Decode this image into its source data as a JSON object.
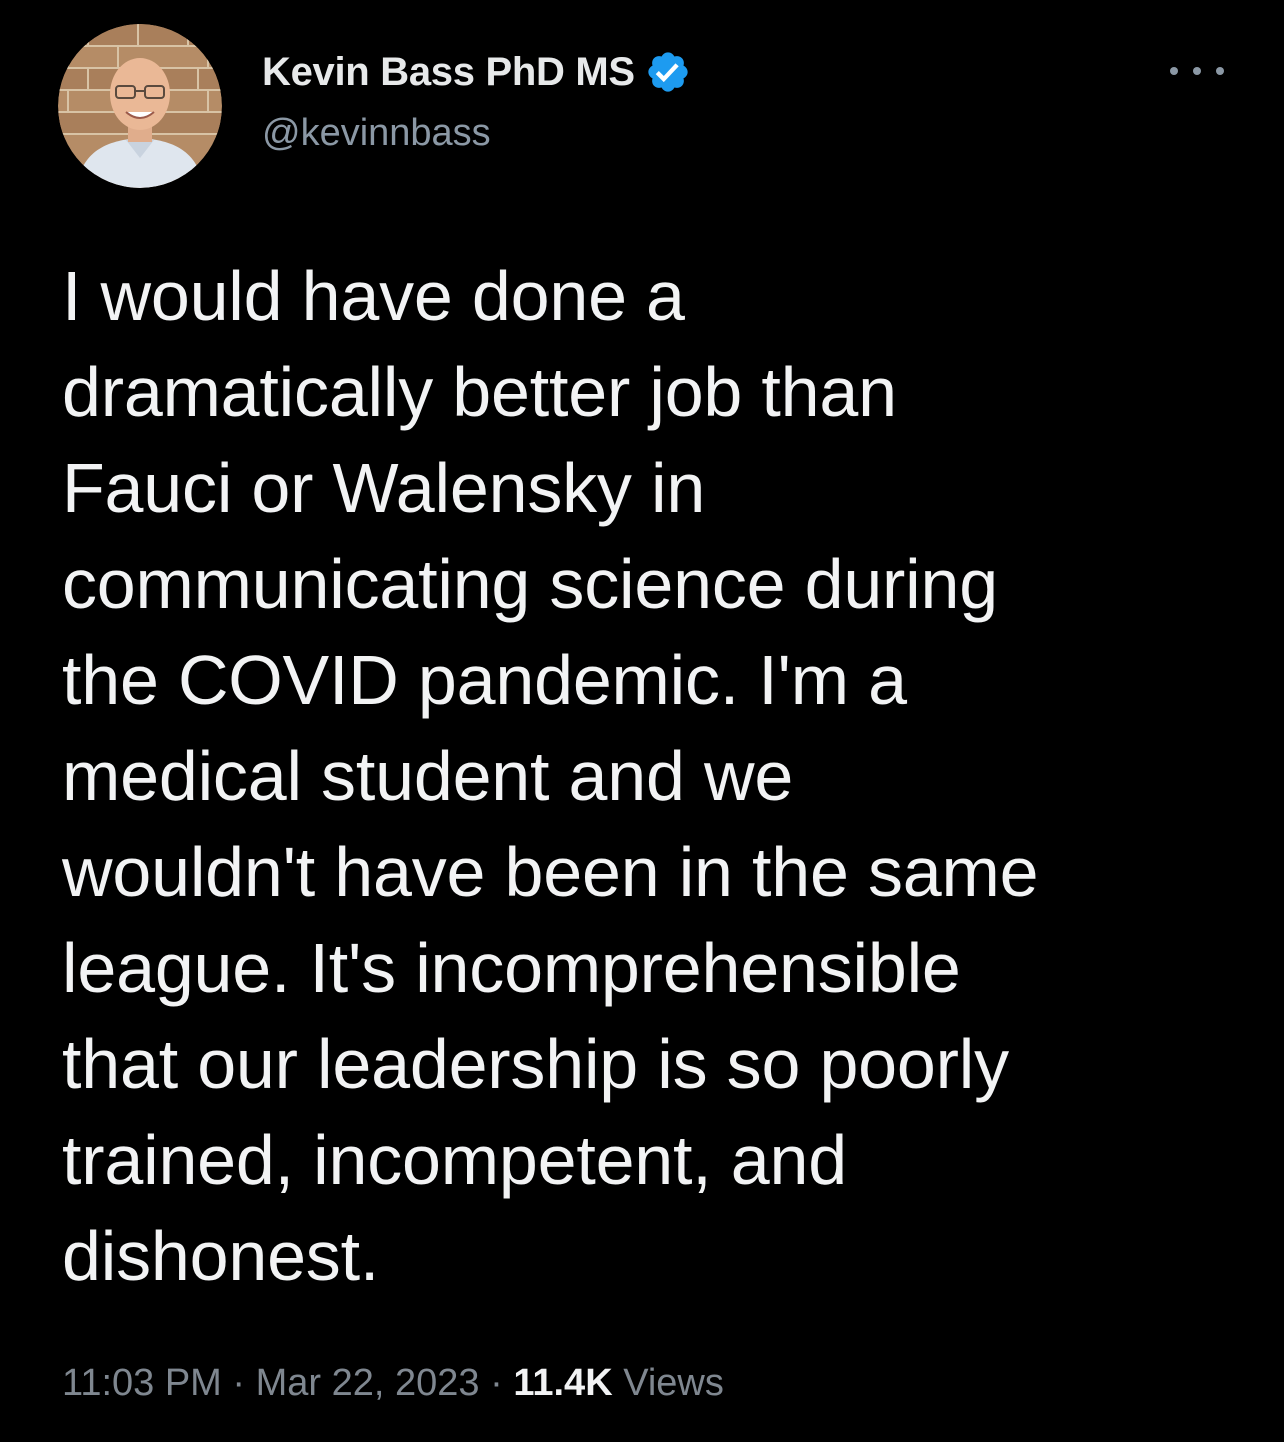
{
  "author": {
    "display_name": "Kevin Bass PhD MS",
    "handle": "@kevinnbass",
    "verified_icon": "verified-badge-icon",
    "avatar_icon": "profile-avatar"
  },
  "menu": {
    "icon": "more-options-icon"
  },
  "tweet": {
    "text": "I would have done a\ndramatically better job than\nFauci or Walensky in\ncommunicating science during\nthe COVID pandemic. I'm a\nmedical student and we\nwouldn't have been in the same\nleague. It's incomprehensible\nthat our leadership is so poorly\ntrained, incompetent, and\ndishonest."
  },
  "meta": {
    "time": "11:03 PM",
    "sep1": " · ",
    "date": "Mar 22, 2023",
    "sep2": " · ",
    "views_count": "11.4K",
    "views_label": " Views"
  },
  "colors": {
    "background": "#000000",
    "text": "#e7e9ea",
    "secondary": "#8b98a5",
    "verified_blue": "#1d9bf0"
  }
}
